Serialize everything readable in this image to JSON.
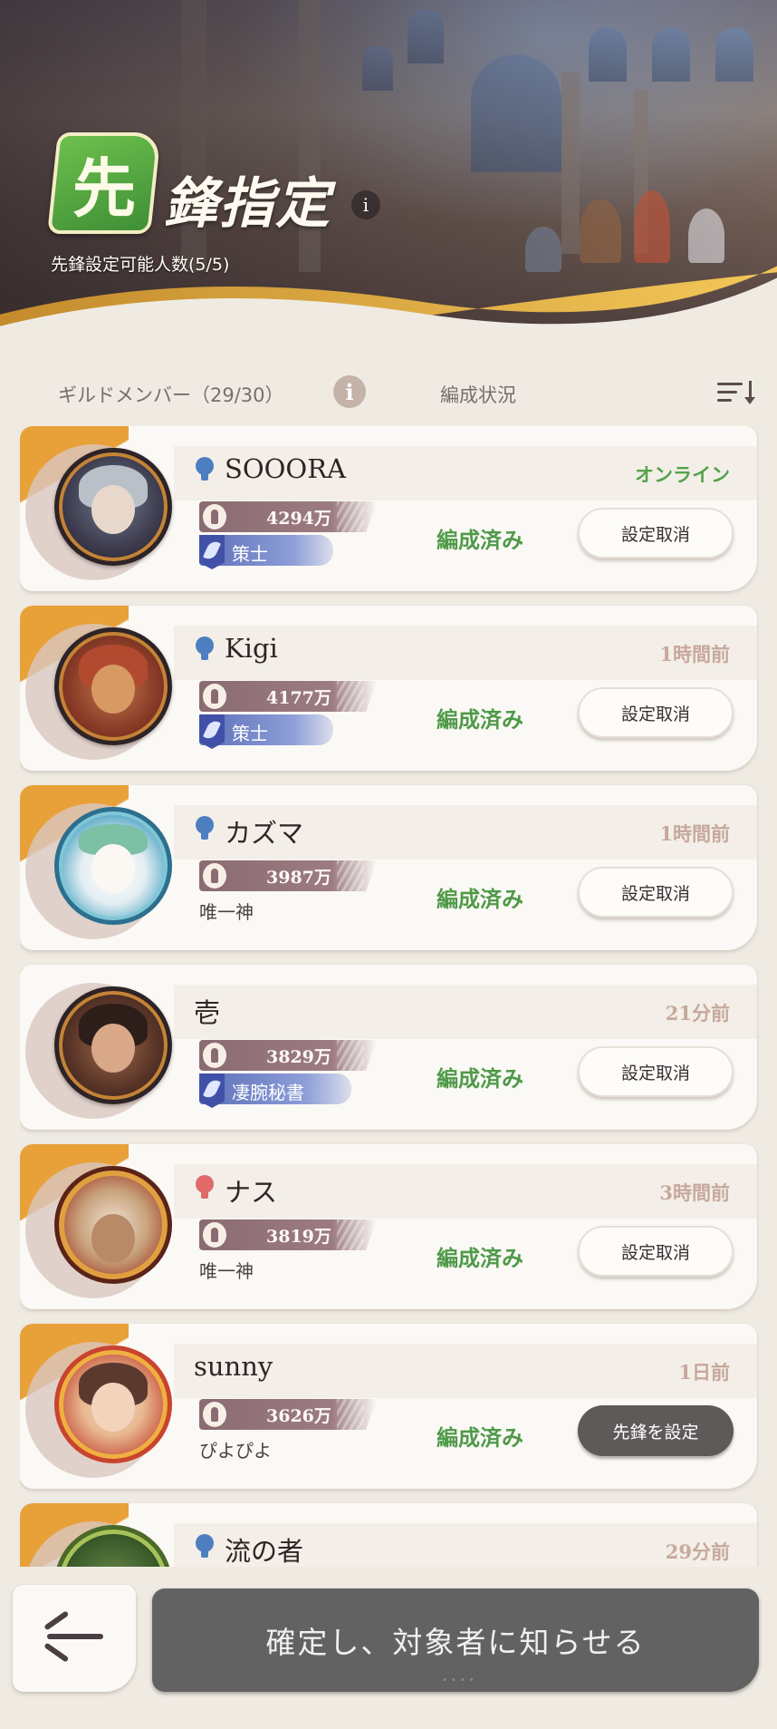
{
  "header": {
    "badge_char": "先",
    "title": "鋒指定",
    "info_icon": "i",
    "subtitle": "先鋒設定可能人数(5/5)"
  },
  "columns": {
    "members": "ギルドメンバー（29/30）",
    "info_icon": "i",
    "status": "編成状況",
    "sort_icon": "sort-icon"
  },
  "members": [
    {
      "name": "SOOORA",
      "gender": "male",
      "last_seen": "オンライン",
      "online": true,
      "power": "4294万",
      "role": "策士",
      "title": "",
      "status": "編成済み",
      "action": "設定取消"
    },
    {
      "name": "Kigi",
      "gender": "male",
      "last_seen": "1時間前",
      "online": false,
      "power": "4177万",
      "role": "策士",
      "title": "",
      "status": "編成済み",
      "action": "設定取消"
    },
    {
      "name": "カズマ",
      "gender": "male",
      "last_seen": "1時間前",
      "online": false,
      "power": "3987万",
      "role": "",
      "title": "唯一神",
      "status": "編成済み",
      "action": "設定取消"
    },
    {
      "name": "壱",
      "gender": "none",
      "last_seen": "21分前",
      "online": false,
      "power": "3829万",
      "role": "凄腕秘書",
      "title": "",
      "status": "編成済み",
      "action": "設定取消"
    },
    {
      "name": "ナス",
      "gender": "female",
      "last_seen": "3時間前",
      "online": false,
      "power": "3819万",
      "role": "",
      "title": "唯一神",
      "status": "編成済み",
      "action": "設定取消"
    },
    {
      "name": "sunny",
      "gender": "none",
      "last_seen": "1日前",
      "online": false,
      "power": "3626万",
      "role": "",
      "title": "ぴよぴよ",
      "status": "編成済み",
      "action": "先鋒を設定"
    },
    {
      "name": "流の者",
      "gender": "male",
      "last_seen": "29分前",
      "online": false,
      "power": "",
      "role": "",
      "title": "",
      "status": "",
      "action": ""
    }
  ],
  "footer": {
    "back_icon": "back-arrow-icon",
    "confirm_label": "確定し、対象者に知らせる",
    "confirm_dots": "••••"
  },
  "colors": {
    "accent_green": "#4f9a48",
    "online_green": "#55a24c",
    "male_icon": "#4d7fc0",
    "female_icon": "#e06a6a",
    "card_corner": "#e8a138",
    "power_bar": "#8a6b71",
    "role_tag": "#5d6fb8"
  }
}
